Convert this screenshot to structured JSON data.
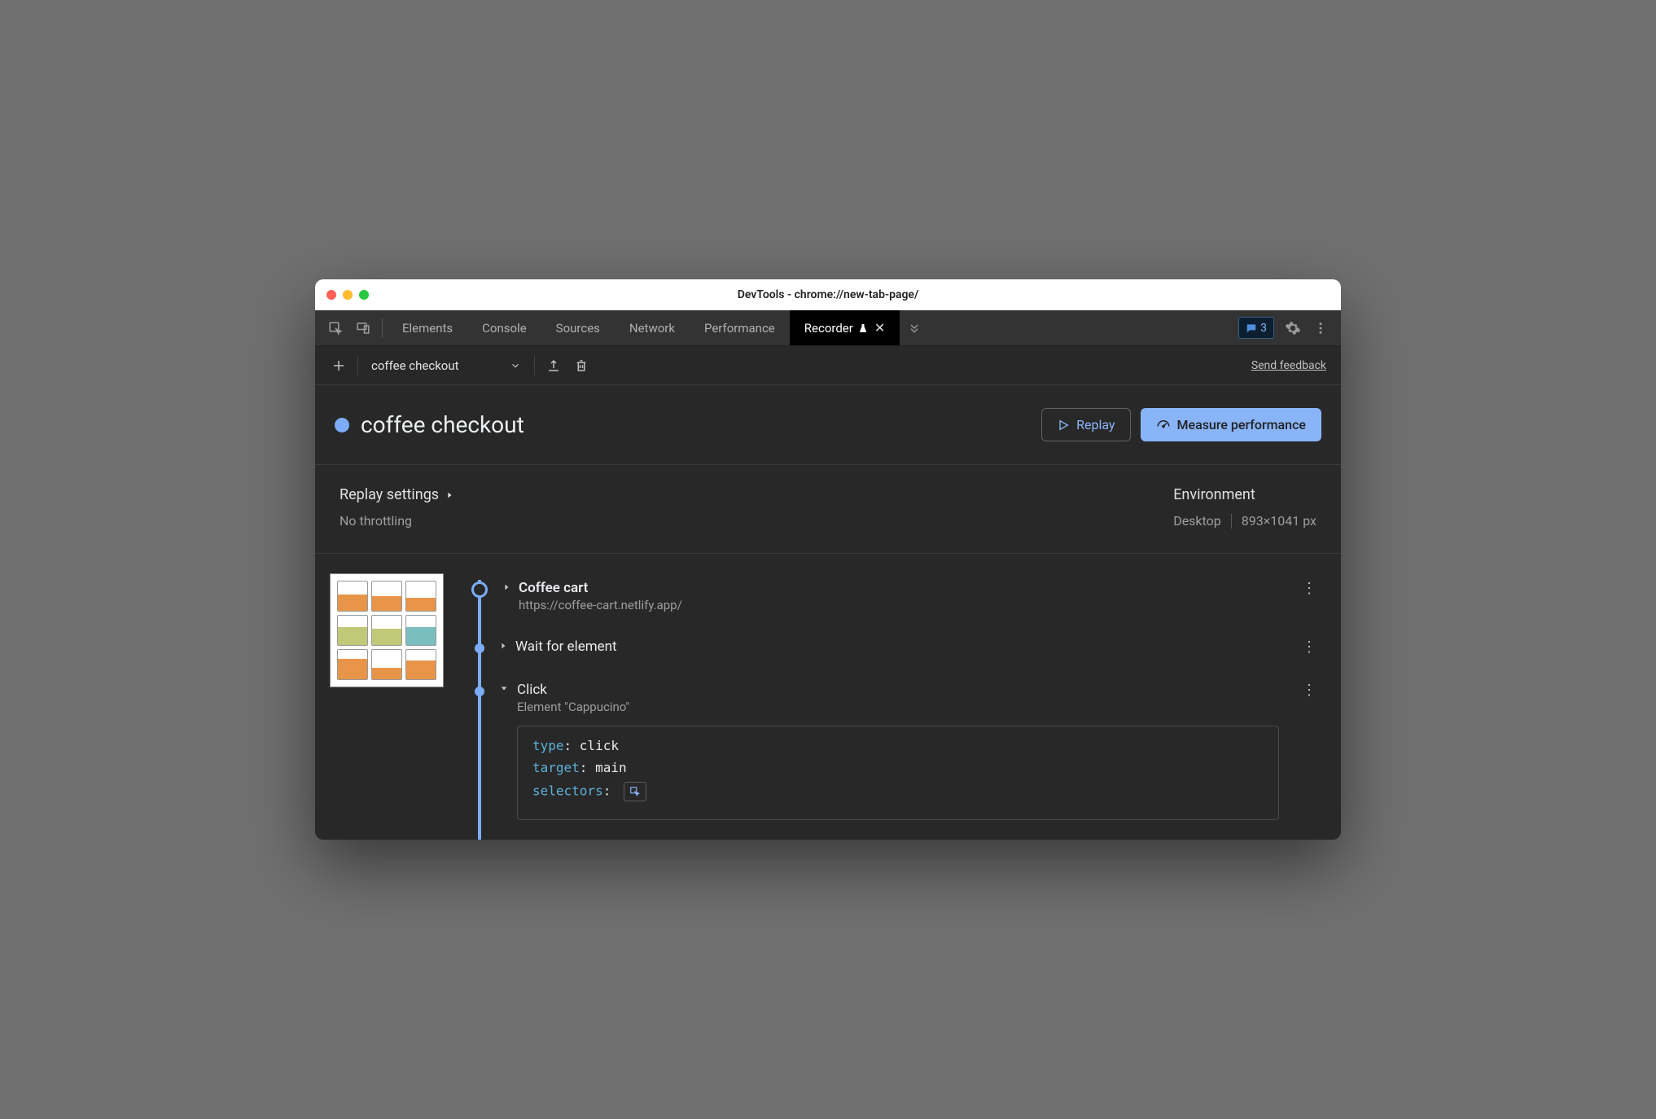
{
  "window": {
    "title": "DevTools - chrome://new-tab-page/"
  },
  "tabs": {
    "items": [
      "Elements",
      "Console",
      "Sources",
      "Network",
      "Performance",
      "Recorder"
    ],
    "msg_count": "3"
  },
  "toolbar": {
    "recording_name": "coffee checkout",
    "feedback": "Send feedback"
  },
  "header": {
    "title": "coffee checkout",
    "replay_label": "Replay",
    "measure_label": "Measure performance"
  },
  "settings": {
    "title": "Replay settings",
    "throttling": "No throttling",
    "env_title": "Environment",
    "env_device": "Desktop",
    "env_size": "893×1041 px"
  },
  "steps": {
    "s0": {
      "title": "Coffee cart",
      "url": "https://coffee-cart.netlify.app/"
    },
    "s1": {
      "title": "Wait for element"
    },
    "s2": {
      "title": "Click",
      "sub": "Element \"Cappucino\"",
      "code": {
        "type_key": "type",
        "type_val": ": click",
        "target_key": "target",
        "target_val": ": main",
        "selectors_key": "selectors",
        "selectors_val": ":"
      }
    }
  }
}
